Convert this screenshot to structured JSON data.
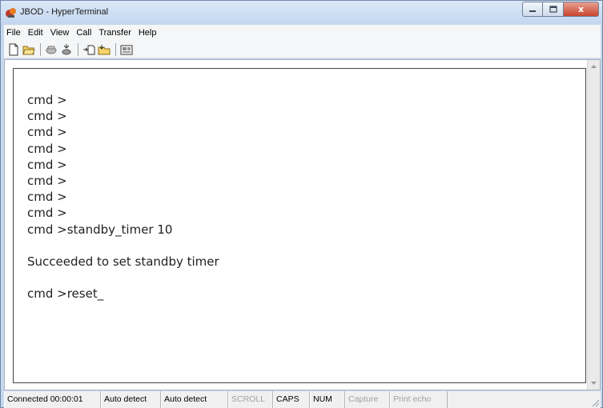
{
  "window": {
    "title": "JBOD - HyperTerminal",
    "close_glyph": "x"
  },
  "menu": [
    {
      "label": "File"
    },
    {
      "label": "Edit"
    },
    {
      "label": "View"
    },
    {
      "label": "Call"
    },
    {
      "label": "Transfer"
    },
    {
      "label": "Help"
    }
  ],
  "toolbar": {
    "icons": [
      "new-icon",
      "open-icon",
      "call-icon",
      "disconnect-icon",
      "send-icon",
      "receive-icon",
      "properties-icon"
    ]
  },
  "terminal": {
    "lines": [
      "cmd >",
      "cmd >",
      "cmd >",
      "cmd >",
      "cmd >",
      "cmd >",
      "cmd >",
      "cmd >",
      "cmd >standby_timer 10",
      "",
      "Succeeded to set standby timer",
      "",
      "cmd >reset_"
    ]
  },
  "statusbar": {
    "connected": "Connected 00:00:01",
    "detect1": "Auto detect",
    "detect2": "Auto detect",
    "scroll": "SCROLL",
    "caps": "CAPS",
    "num": "NUM",
    "capture": "Capture",
    "print_echo": "Print echo"
  },
  "colors": {
    "frame": "#c6d8ee",
    "close_button": "#c8452f"
  }
}
